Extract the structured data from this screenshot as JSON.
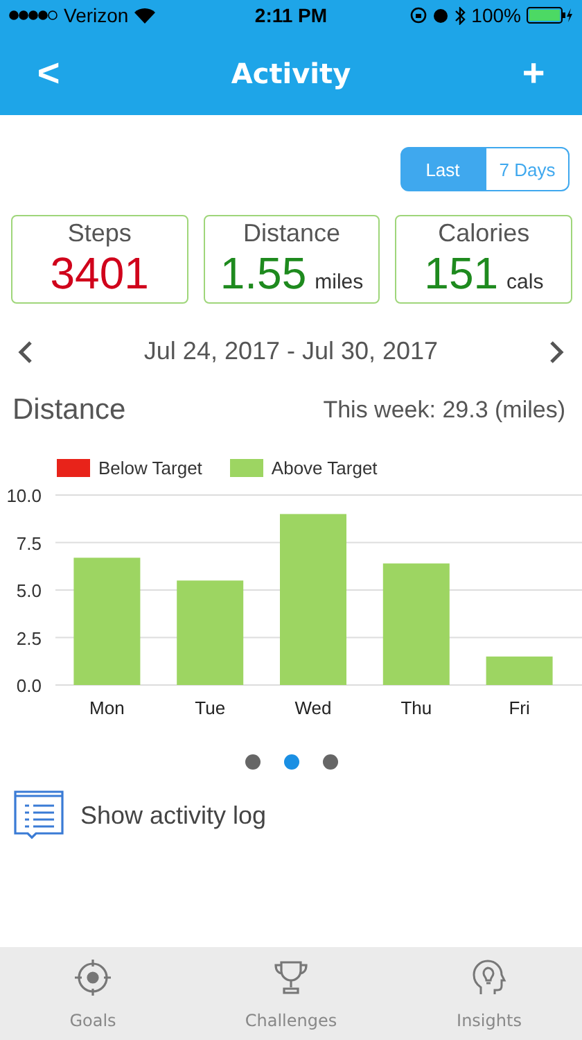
{
  "status_bar": {
    "carrier": "Verizon",
    "time": "2:11 PM",
    "battery": "100%"
  },
  "nav": {
    "back": "<",
    "title": "Activity",
    "add": "+"
  },
  "range_toggle": [
    {
      "label": "Last",
      "selected": true
    },
    {
      "label": "7 Days",
      "selected": false
    }
  ],
  "stats": [
    {
      "label": "Steps",
      "value": "3401",
      "color": "#d0021b"
    },
    {
      "label": "Distance",
      "value": "1.55",
      "unit": "miles",
      "color": "#1e8a1e"
    },
    {
      "label": "Calories",
      "value": "151",
      "unit": "cals",
      "color": "#1e8a1e"
    }
  ],
  "date_range": "Jul 24, 2017 - Jul 30, 2017",
  "section": {
    "title": "Distance",
    "summary": "This week: 29.3 (miles)",
    "chart_data": {
      "type": "bar",
      "grid": true,
      "categories": [
        "Mon",
        "Tue",
        "Wed",
        "Thu",
        "Fri"
      ],
      "ylim": [
        0,
        10
      ],
      "yticks": [
        {
          "value": 0,
          "label": "0.0"
        },
        {
          "value": 2.5,
          "label": "2.5"
        },
        {
          "value": 5,
          "label": "5.0"
        },
        {
          "value": 7.5,
          "label": "7.5"
        },
        {
          "value": 10,
          "label": "10.0"
        }
      ],
      "series": [
        {
          "name": "Below Target",
          "color": "#e8231a",
          "values": [
            null,
            null,
            null,
            null,
            null
          ]
        },
        {
          "name": "Above Target",
          "color": "#9dd562",
          "values": [
            6.7,
            5.5,
            9.0,
            6.4,
            1.5
          ]
        }
      ]
    }
  },
  "pages": [
    {
      "selected": false
    },
    {
      "selected": true
    },
    {
      "selected": false
    }
  ],
  "activity_log": "Show activity log",
  "tabs": [
    {
      "label": "Goals",
      "kind": "goals"
    },
    {
      "label": "Challenges",
      "kind": "challenges"
    },
    {
      "label": "Insights",
      "kind": "insights"
    }
  ]
}
